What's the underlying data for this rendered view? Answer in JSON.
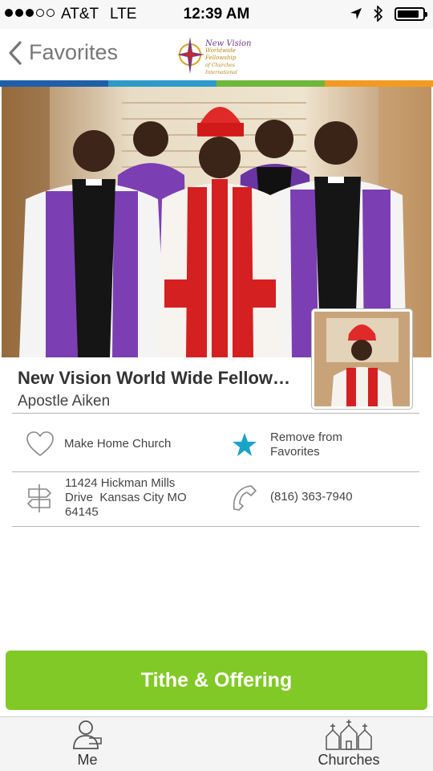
{
  "status": {
    "carrier": "AT&T",
    "network": "LTE",
    "time": "12:39 AM",
    "battery_level": 0.85,
    "signal_bars": 3
  },
  "nav": {
    "back_label": "Favorites",
    "logo": {
      "line1": "New Vision",
      "line2": "Worldwide Fellowship",
      "line3": "of Churches International"
    }
  },
  "colors": {
    "strip": [
      "#1f5fa8",
      "#2d9ac9",
      "#6fb73a",
      "#f29b22"
    ],
    "accent_green": "#81c926",
    "star_blue": "#1aa3c8"
  },
  "church": {
    "name": "New Vision World Wide Fellow…",
    "pastor": "Apostle Aiken"
  },
  "actions": {
    "home_church": "Make Home Church",
    "favorite_line1": "Remove from",
    "favorite_line2": "Favorites",
    "address_line1": "11424 Hickman Mills",
    "address_line2": "Drive  Kansas City MO",
    "address_line3": "64145",
    "phone": "(816) 363-7940"
  },
  "icons": {
    "heart": "heart-icon",
    "star": "star-icon",
    "directions": "signpost-icon",
    "phone": "phone-icon",
    "me": "person-icon",
    "churches": "churches-icon"
  },
  "tithe_label": "Tithe & Offering",
  "tabs": [
    {
      "label": "Me"
    },
    {
      "label": "Churches"
    }
  ]
}
